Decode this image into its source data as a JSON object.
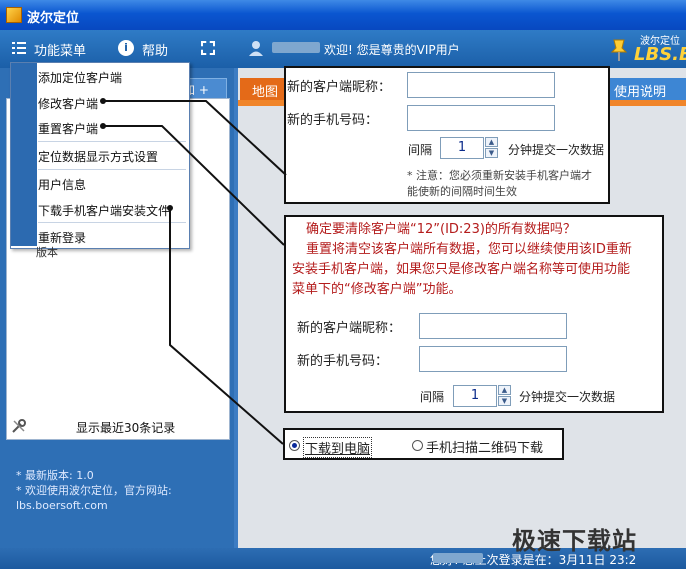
{
  "window": {
    "title": "波尔定位"
  },
  "toolbar": {
    "menu_label": "功能菜单",
    "help_label": "帮助",
    "welcome_text": "欢迎! 您是尊贵的VIP用户",
    "logo_small": "波尔定位",
    "logo_big": "LBS.B"
  },
  "left_panel": {
    "add_button": "加 +",
    "recent_label": "显示最近30条记录",
    "version_lines": [
      "* 最新版本: 1.0",
      "* 欢迎使用波尔定位，官方网站:",
      "lbs.boersoft.com"
    ]
  },
  "tabs": {
    "map": "地图",
    "help": "使用说明"
  },
  "menu": {
    "items": [
      "添加定位客户端",
      "修改客户端",
      "重置客户端",
      "定位数据显示方式设置",
      "用户信息",
      "下载手机客户端安装文件",
      "重新登录"
    ],
    "ghost_text": "版本"
  },
  "edit_dialog": {
    "nickname_label": "新的客户端昵称：",
    "phone_label": "新的手机号码：",
    "interval_prefix": "间隔",
    "interval_value": "1",
    "interval_suffix": "分钟提交一次数据",
    "note_line1": "* 注意：您必须重新安装手机客户端才",
    "note_line2": "能使新的间隔时间生效"
  },
  "reset_dialog": {
    "warning_line1": "确定要清除客户端“12”(ID:23)的所有数据吗？",
    "warning_line2": "重置将清空该客户端所有数据，您可以继续使用该ID重新",
    "warning_line3": "安装手机客户端，如果您只是修改客户端名称等可使用功能",
    "warning_line4": "菜单下的“修改客户端”功能。",
    "nickname_label": "新的客户端昵称：",
    "phone_label": "新的手机号码：",
    "interval_prefix": "间隔",
    "interval_value": "1",
    "interval_suffix": "分钟提交一次数据"
  },
  "download_options": {
    "pc_label": "下载到电脑",
    "qr_label": "手机扫描二维码下载",
    "selected": "下载到电脑"
  },
  "statusbar": {
    "text": "您好! 您上次登录是在：3月11日 23:2"
  },
  "watermark": "极速下载站"
}
